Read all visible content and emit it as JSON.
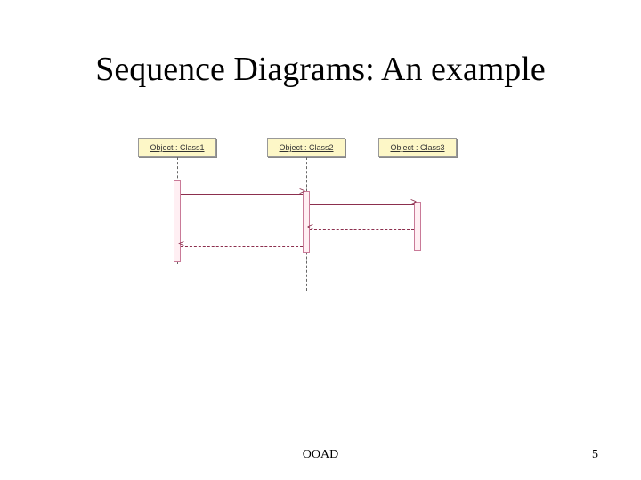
{
  "slide": {
    "title": "Sequence Diagrams: An example",
    "footer_center": "OOAD",
    "page_number": "5"
  },
  "diagram": {
    "objects": [
      {
        "label": "Object : Class1"
      },
      {
        "label": "Object : Class2"
      },
      {
        "label": "Object : Class3"
      }
    ],
    "messages": [
      {
        "from": 1,
        "to": 2,
        "type": "call",
        "arrow_glyph": ">"
      },
      {
        "from": 2,
        "to": 3,
        "type": "call",
        "arrow_glyph": ">"
      },
      {
        "from": 3,
        "to": 2,
        "type": "return",
        "arrow_glyph": "<"
      },
      {
        "from": 2,
        "to": 1,
        "type": "return",
        "arrow_glyph": "<"
      }
    ]
  }
}
